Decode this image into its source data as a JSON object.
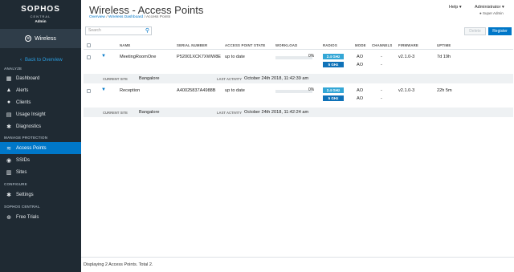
{
  "brand": {
    "name": "SOPHOS",
    "sub": "CENTRAL",
    "tier": "Admin"
  },
  "product": {
    "name": "Wireless",
    "icon": "wifi-circle-icon"
  },
  "back_link": "Back to Overview",
  "sections": {
    "analyze": "ANALYZE",
    "manage": "MANAGE PROTECTION",
    "configure": "CONFIGURE",
    "central": "SOPHOS CENTRAL"
  },
  "nav": {
    "dashboard": "Dashboard",
    "alerts": "Alerts",
    "clients": "Clients",
    "usage": "Usage Insight",
    "diagnostics": "Diagnostics",
    "access_points": "Access Points",
    "ssids": "SSIDs",
    "sites": "Sites",
    "settings": "Settings",
    "free_trials": "Free Trials"
  },
  "header": {
    "title": "Wireless - Access Points",
    "breadcrumb": [
      "Overview",
      "Wireless Dashboard",
      "Access Points"
    ],
    "help": "Help",
    "user": "Administrator",
    "role": "Super Admin"
  },
  "toolbar": {
    "search_placeholder": "Search",
    "delete_label": "Delete",
    "register_label": "Register"
  },
  "table": {
    "columns": [
      "NAME",
      "SERIAL NUMBER",
      "ACCESS POINT STATE",
      "WORKLOAD",
      "RADIOS",
      "MODE",
      "CHANNELS",
      "FIRMWARE",
      "UPTIME"
    ],
    "current_site_label": "CURRENT SITE",
    "last_activity_label": "LAST ACTIVITY",
    "rows": [
      {
        "name": "MeetingRoomOne",
        "serial": "P52001XCK7XWW8E",
        "state": "up to date",
        "workload": "0%",
        "radio1": "2.4 GHz",
        "radio2": "5 GHz",
        "mode1": "AO",
        "mode2": "AO",
        "ch1": "-",
        "ch2": "-",
        "firmware": "v2.1.0-3",
        "uptime": "7d 19h",
        "site": "Bangalore",
        "last_activity": "October 24th 2018, 11:42:39 am"
      },
      {
        "name": "Reception",
        "serial": "A40025837A4988B",
        "state": "up to date",
        "workload": "0%",
        "radio1": "2.4 GHz",
        "radio2": "5 GHz",
        "mode1": "AO",
        "mode2": "AO",
        "ch1": "-",
        "ch2": "-",
        "firmware": "v2.1.0-3",
        "uptime": "22h 5m",
        "site": "Bangalore",
        "last_activity": "October 24th 2018, 11:42:24 am"
      }
    ]
  },
  "footer": "Displaying 2 Access Points. Total 2.",
  "colors": {
    "sidebar": "#1f2a33",
    "accent": "#0077c8",
    "radio_24": "#34a7d6",
    "radio_5": "#0f72b8"
  }
}
